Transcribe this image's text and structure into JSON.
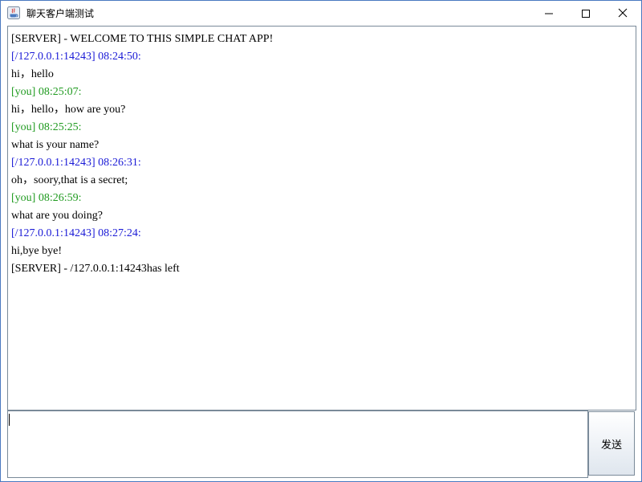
{
  "window": {
    "title": "聊天客户端测试",
    "app_icon": "java-icon",
    "controls": [
      "minimize-icon",
      "maximize-icon",
      "close-icon"
    ]
  },
  "chat": {
    "messages": [
      {
        "kind": "server",
        "text": "[SERVER] - WELCOME TO THIS SIMPLE CHAT APP!"
      },
      {
        "kind": "peer",
        "text": "[/127.0.0.1:14243] 08:24:50:"
      },
      {
        "kind": "text",
        "text": "hi，hello"
      },
      {
        "kind": "you",
        "text": "[you] 08:25:07:"
      },
      {
        "kind": "text",
        "text": "hi，hello，how are you?"
      },
      {
        "kind": "you",
        "text": "[you] 08:25:25:"
      },
      {
        "kind": "text",
        "text": "what is your name?"
      },
      {
        "kind": "peer",
        "text": "[/127.0.0.1:14243] 08:26:31:"
      },
      {
        "kind": "text",
        "text": "oh，soory,that is a secret;"
      },
      {
        "kind": "you",
        "text": "[you] 08:26:59:"
      },
      {
        "kind": "text",
        "text": "what are you doing?"
      },
      {
        "kind": "peer",
        "text": "[/127.0.0.1:14243] 08:27:24:"
      },
      {
        "kind": "text",
        "text": "hi,bye bye!"
      },
      {
        "kind": "server",
        "text": "[SERVER] - /127.0.0.1:14243has left"
      }
    ]
  },
  "input": {
    "value": ""
  },
  "send_button": {
    "label": "发送"
  },
  "colors": {
    "peer": "#1a1ad6",
    "you": "#1f9a1f",
    "server": "#000000",
    "window_border": "#4a79c0"
  }
}
